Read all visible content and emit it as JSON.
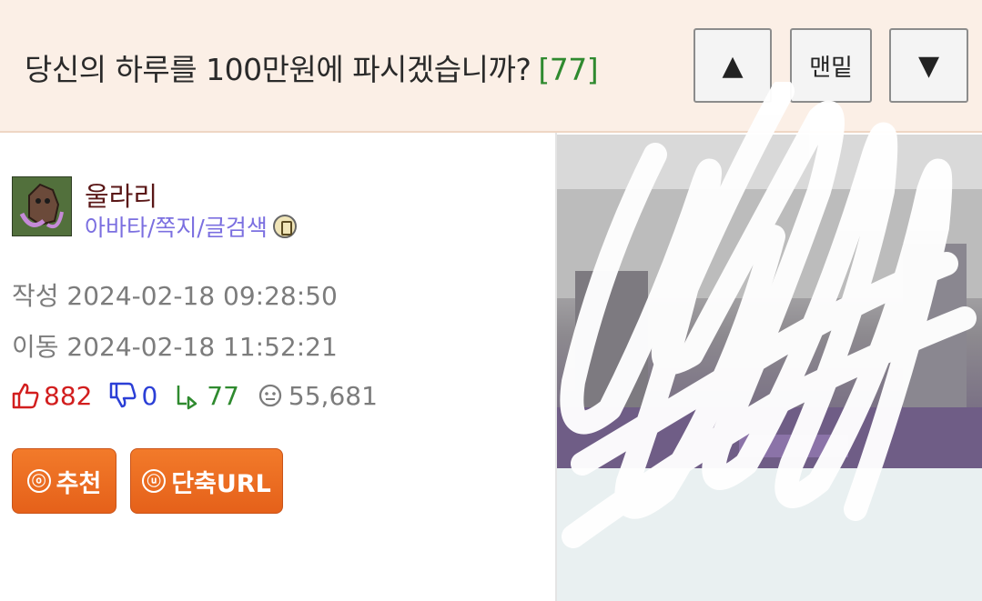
{
  "header": {
    "title": "당신의 하루를 100만원에 파시겠습니까?",
    "comment_count": "[77]",
    "nav": {
      "up": "▲",
      "bottom": "맨밑",
      "down": "▼"
    }
  },
  "author": {
    "nickname": "울라리",
    "links": "아바타/쪽지/글검색"
  },
  "meta": {
    "created": "작성 2024-02-18 09:28:50",
    "moved": "이동 2024-02-18 11:52:21"
  },
  "stats": {
    "upvotes": "882",
    "downvotes": "0",
    "replies": "77",
    "views": "55,681"
  },
  "buttons": {
    "recommend": "추천",
    "recommend_icon": "ⓞ",
    "short_url": "단축URL",
    "short_url_icon": "ⓤ"
  },
  "colors": {
    "header_bg": "#fbefe6",
    "accent_orange": "#e9681f",
    "upvote_red": "#d21e1e",
    "downvote_blue": "#2b3fd6",
    "reply_green": "#2f8a2f",
    "nick_color": "#5a1717",
    "link_purple": "#7b6fe0"
  }
}
